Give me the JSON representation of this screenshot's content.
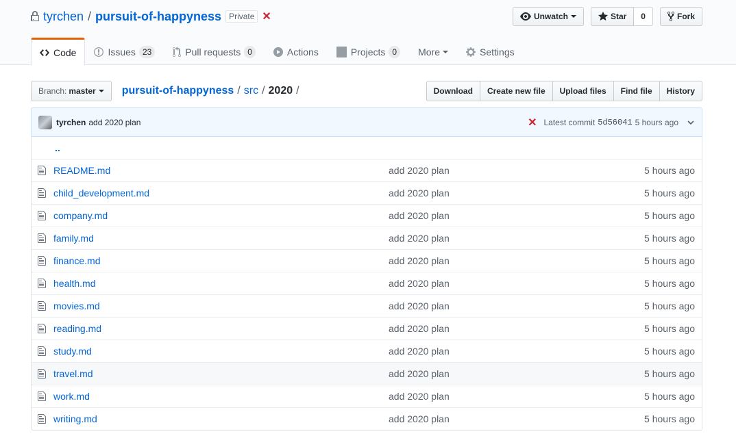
{
  "repo": {
    "owner": "tyrchen",
    "name": "pursuit-of-happyness",
    "visibility": "Private",
    "status_icon": "x-icon"
  },
  "actions": {
    "watch_label": "Unwatch",
    "star_label": "Star",
    "star_count": "0",
    "fork_label": "Fork"
  },
  "tabs": [
    {
      "label": "Code",
      "icon": "code-icon"
    },
    {
      "label": "Issues",
      "count": "23",
      "icon": "issue-opened-icon"
    },
    {
      "label": "Pull requests",
      "count": "0",
      "icon": "git-pull-request-icon"
    },
    {
      "label": "Actions",
      "icon": "play-icon"
    },
    {
      "label": "Projects",
      "count": "0",
      "icon": "project-icon"
    },
    {
      "label": "More",
      "icon": "chevron-down-icon"
    },
    {
      "label": "Settings",
      "icon": "gear-icon"
    }
  ],
  "file_nav": {
    "branch_prefix": "Branch:",
    "branch": "master",
    "breadcrumb_root": "pursuit-of-happyness",
    "breadcrumb_dir": "src",
    "breadcrumb_current": "2020",
    "sep": "/",
    "buttons": [
      "Download",
      "Create new file",
      "Upload files",
      "Find file",
      "History"
    ]
  },
  "commit": {
    "author": "tyrchen",
    "message": "add 2020 plan",
    "latest_label": "Latest commit",
    "sha": "5d56041",
    "age": "5 hours ago"
  },
  "parent_link": "..",
  "files": [
    {
      "name": "README.md",
      "message": "add 2020 plan",
      "age": "5 hours ago"
    },
    {
      "name": "child_development.md",
      "message": "add 2020 plan",
      "age": "5 hours ago"
    },
    {
      "name": "company.md",
      "message": "add 2020 plan",
      "age": "5 hours ago"
    },
    {
      "name": "family.md",
      "message": "add 2020 plan",
      "age": "5 hours ago"
    },
    {
      "name": "finance.md",
      "message": "add 2020 plan",
      "age": "5 hours ago"
    },
    {
      "name": "health.md",
      "message": "add 2020 plan",
      "age": "5 hours ago"
    },
    {
      "name": "movies.md",
      "message": "add 2020 plan",
      "age": "5 hours ago"
    },
    {
      "name": "reading.md",
      "message": "add 2020 plan",
      "age": "5 hours ago"
    },
    {
      "name": "study.md",
      "message": "add 2020 plan",
      "age": "5 hours ago"
    },
    {
      "name": "travel.md",
      "message": "add 2020 plan",
      "age": "5 hours ago"
    },
    {
      "name": "work.md",
      "message": "add 2020 plan",
      "age": "5 hours ago"
    },
    {
      "name": "writing.md",
      "message": "add 2020 plan",
      "age": "5 hours ago"
    }
  ],
  "highlighted_row": "travel.md",
  "colors": {
    "link": "#0366d6",
    "danger": "#cb2431",
    "tab_accent": "#e36209",
    "commit_bg": "#f1f8ff"
  }
}
